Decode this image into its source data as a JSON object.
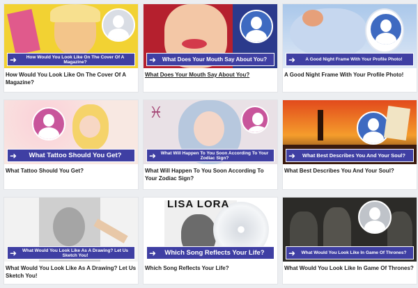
{
  "cards": [
    {
      "banner": "How Would You Look Like On The Cover Of A Magazine?",
      "caption": "How Would You Look Like On The Cover Of A Magazine?"
    },
    {
      "banner": "What Does Your Mouth Say About You?",
      "caption": "What Does Your Mouth Say About You?"
    },
    {
      "banner": "A Good Night Frame With Your Profile Photo!",
      "caption": "A Good Night Frame With Your Profile Photo!"
    },
    {
      "banner": "What Tattoo Should You Get?",
      "caption": "What Tattoo Should You Get?"
    },
    {
      "banner": "What Will Happen To You Soon According To Your Zodiac Sign?",
      "caption": "What Will Happen To You Soon According To Your Zodiac Sign?"
    },
    {
      "banner": "What Best Describes You And Your Soul?",
      "caption": "What Best Describes You And Your Soul?"
    },
    {
      "banner": "What Would You Look Like As A Drawing? Let Us Sketch You!",
      "caption": "What Would You Look Like As A Drawing? Let Us Sketch You!"
    },
    {
      "banner": "Which Song Reflects Your Life?",
      "caption": "Which Song Reflects Your Life?",
      "album_text": "LISA LORA"
    },
    {
      "banner": "What Would You Look Like In Game Of Thrones?",
      "caption": "What Would You Look Like In Game Of Thrones?"
    }
  ],
  "icons": {
    "banner_arrow": "➜"
  },
  "colors": {
    "banner": "#3f3fa3",
    "avatar_blue": "#3e6ac1",
    "avatar_pink": "#c8559b"
  }
}
